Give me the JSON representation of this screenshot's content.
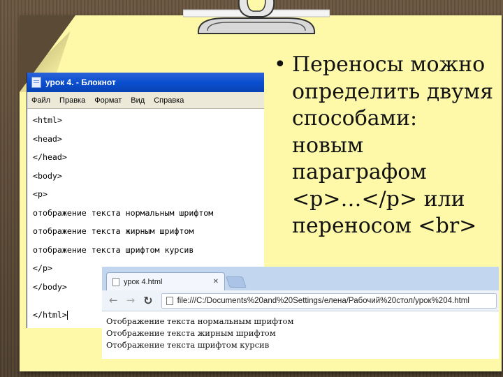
{
  "slide": {
    "bullet": "•",
    "text": "Переносы можно\nопределить двумя\nспособами:\nновым\nпараграфом\n<p>…</p> или\nпереносом <br>"
  },
  "notepad": {
    "title": "урок 4. - Блокнот",
    "menu": [
      "Файл",
      "Правка",
      "Формат",
      "Вид",
      "Справка"
    ],
    "lines": [
      "<html>",
      "<head>",
      "</head>",
      "<body>",
      "<p>",
      "отображение текста нормальным шрифтом",
      "отображение текста жирным шрифтом",
      "отображение текста шрифтом курсив",
      "</p>",
      "</body>",
      "",
      "</html>"
    ]
  },
  "browser": {
    "tab_title": "урок 4.html",
    "tab_close": "✕",
    "address": "file:///C:/Documents%20and%20Settings/елена/Рабочий%20стол/урок%204.html",
    "content_lines": [
      "Отображение текста нормальным шрифтом",
      "Отображение текста жирным шрифтом",
      "Отображение текста шрифтом курсив"
    ]
  },
  "icons": {
    "back": "back-arrow-icon",
    "forward": "forward-arrow-icon",
    "reload": "reload-icon",
    "page": "page-icon"
  },
  "colors": {
    "paper": "#fdf9a8",
    "wood": "#5b4a36",
    "xp_titlebar": "#0a4fd0"
  }
}
